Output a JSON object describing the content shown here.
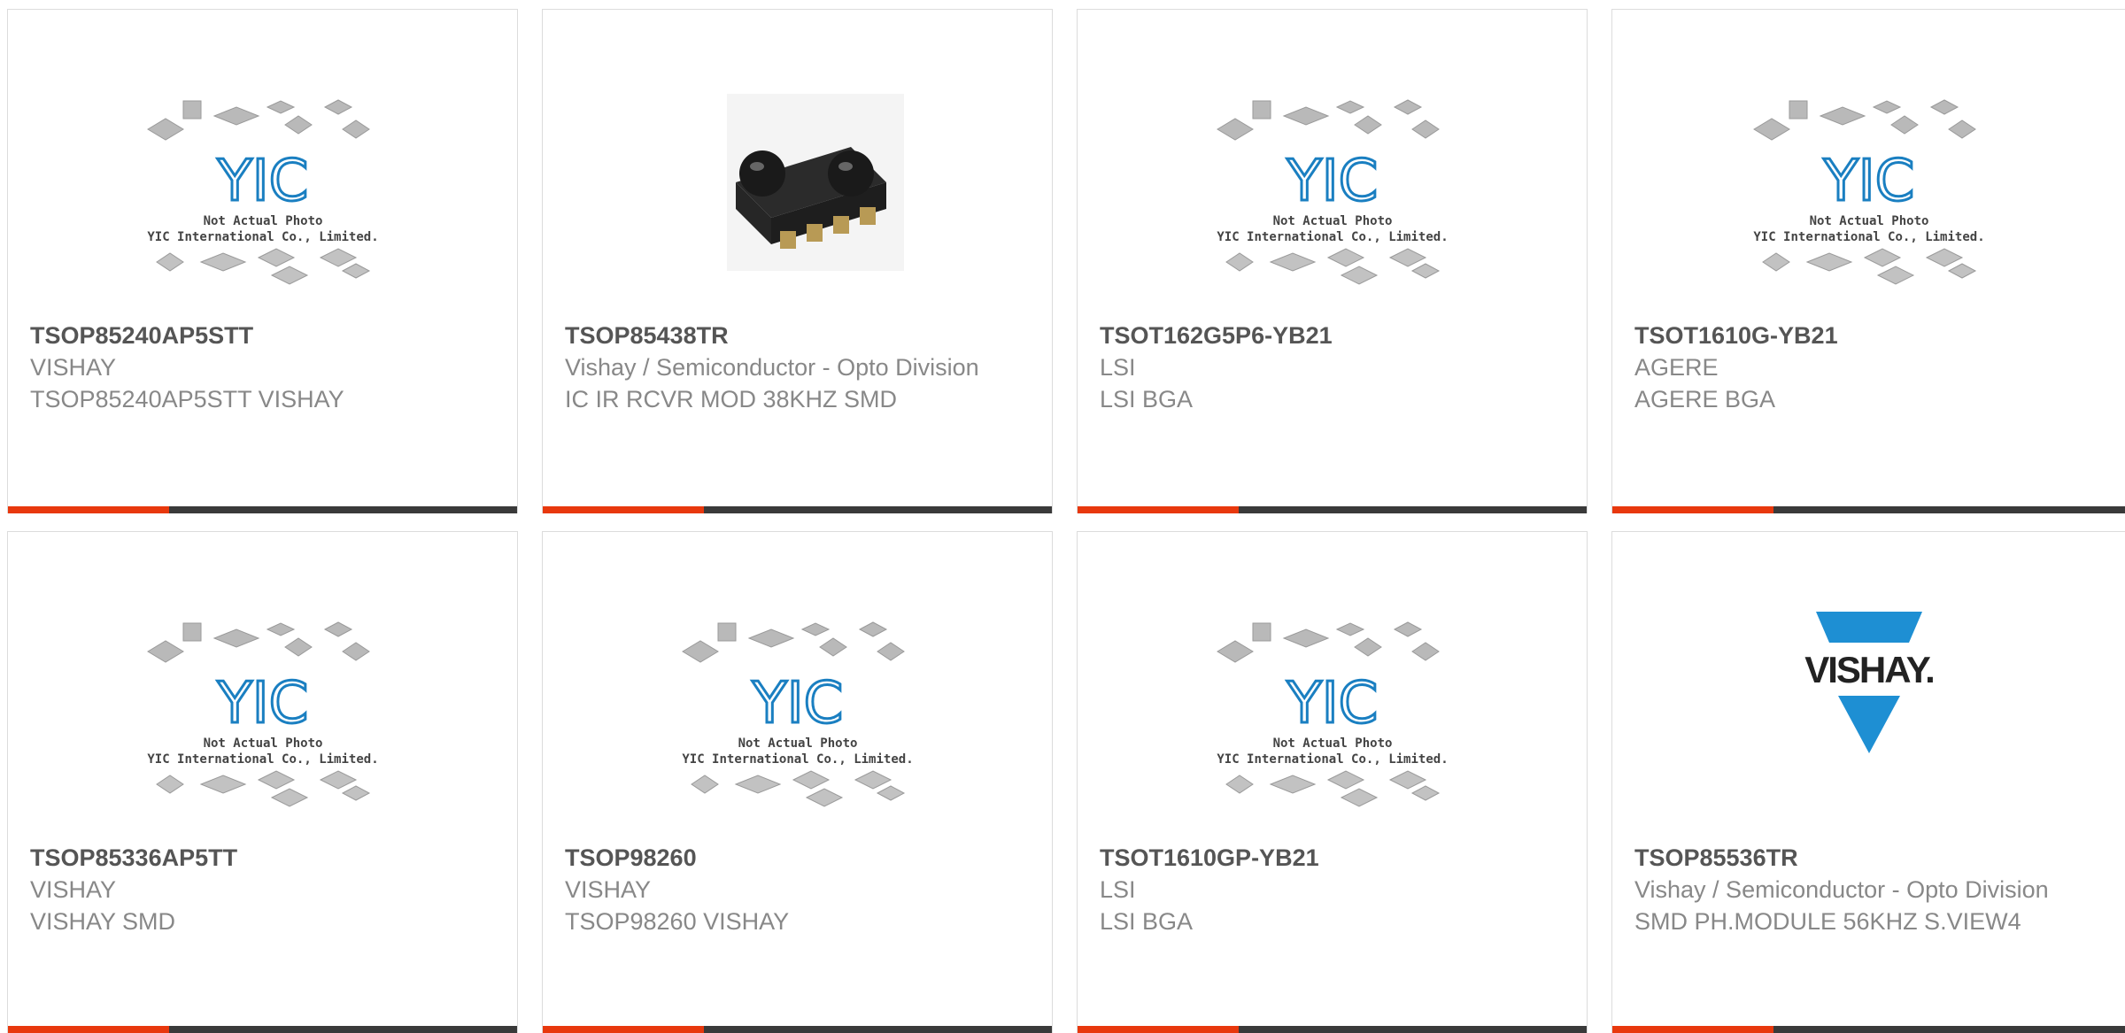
{
  "products": [
    {
      "part_number": "TSOP85240AP5STT",
      "manufacturer": "VISHAY",
      "description": "TSOP85240AP5STT VISHAY",
      "image": "placeholder",
      "placeholder_lines": [
        "Not Actual Photo",
        "YIC International Co., Limited."
      ]
    },
    {
      "part_number": "TSOP85438TR",
      "manufacturer": "Vishay / Semiconductor - Opto Division",
      "description": "IC IR RCVR MOD 38KHZ SMD",
      "image": "ir-receiver-photo"
    },
    {
      "part_number": "TSOT162G5P6-YB21",
      "manufacturer": "LSI",
      "description": "LSI BGA",
      "image": "placeholder",
      "placeholder_lines": [
        "Not Actual Photo",
        "YIC International Co., Limited."
      ]
    },
    {
      "part_number": "TSOT1610G-YB21",
      "manufacturer": "AGERE",
      "description": "AGERE BGA",
      "image": "placeholder",
      "placeholder_lines": [
        "Not Actual Photo",
        "YIC International Co., Limited."
      ]
    },
    {
      "part_number": "TSOP85336AP5TT",
      "manufacturer": "VISHAY",
      "description": "VISHAY SMD",
      "image": "placeholder",
      "placeholder_lines": [
        "Not Actual Photo",
        "YIC International Co., Limited."
      ]
    },
    {
      "part_number": "TSOP98260",
      "manufacturer": "VISHAY",
      "description": "TSOP98260 VISHAY",
      "image": "placeholder",
      "placeholder_lines": [
        "Not Actual Photo",
        "YIC International Co., Limited."
      ]
    },
    {
      "part_number": "TSOT1610GP-YB21",
      "manufacturer": "LSI",
      "description": "LSI BGA",
      "image": "placeholder",
      "placeholder_lines": [
        "Not Actual Photo",
        "YIC International Co., Limited."
      ]
    },
    {
      "part_number": "TSOP85536TR",
      "manufacturer": "Vishay / Semiconductor - Opto Division",
      "description": "SMD PH.MODULE 56KHZ S.VIEW4",
      "image": "vishay-logo",
      "logo_text": "VISHAY."
    }
  ],
  "colors": {
    "accent": "#e8380d",
    "bar": "#3a3a3a",
    "yic_blue": "#1a7fc1",
    "vishay_blue": "#1e8fd3"
  }
}
